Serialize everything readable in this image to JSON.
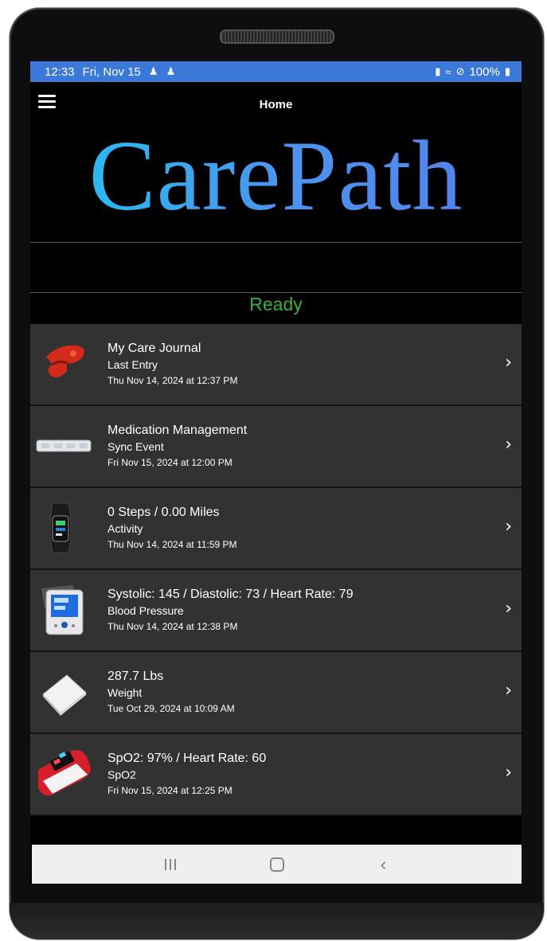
{
  "status_bar": {
    "time": "12:33",
    "date": "Fri, Nov 15",
    "battery": "100%"
  },
  "header": {
    "title": "Home"
  },
  "logo_text": "CarePath",
  "status_text": "Ready",
  "items": [
    {
      "title": "My Care Journal",
      "subtitle": "Last Entry",
      "date": "Thu Nov 14, 2024 at 12:37 PM",
      "icon": "journal-icon"
    },
    {
      "title": "Medication Management",
      "subtitle": "Sync Event",
      "date": "Fri Nov 15, 2024 at 12:00 PM",
      "icon": "medication-dispenser-icon"
    },
    {
      "title": "0 Steps / 0.00 Miles",
      "subtitle": "Activity",
      "date": "Thu Nov 14, 2024 at 11:59 PM",
      "icon": "fitness-band-icon"
    },
    {
      "title": "Systolic: 145 / Diastolic: 73 / Heart Rate: 79",
      "subtitle": "Blood Pressure",
      "date": "Thu Nov 14, 2024 at 12:38 PM",
      "icon": "blood-pressure-monitor-icon"
    },
    {
      "title": "287.7 Lbs",
      "subtitle": "Weight",
      "date": "Tue Oct 29, 2024 at 10:09 AM",
      "icon": "scale-icon"
    },
    {
      "title": "SpO2: 97% / Heart Rate: 60",
      "subtitle": "SpO2",
      "date": "Fri Nov 15, 2024 at 12:25 PM",
      "icon": "pulse-oximeter-icon"
    }
  ],
  "colors": {
    "status_bar": "#3c78d8",
    "ready": "#38b238",
    "row_background": "#323232"
  }
}
